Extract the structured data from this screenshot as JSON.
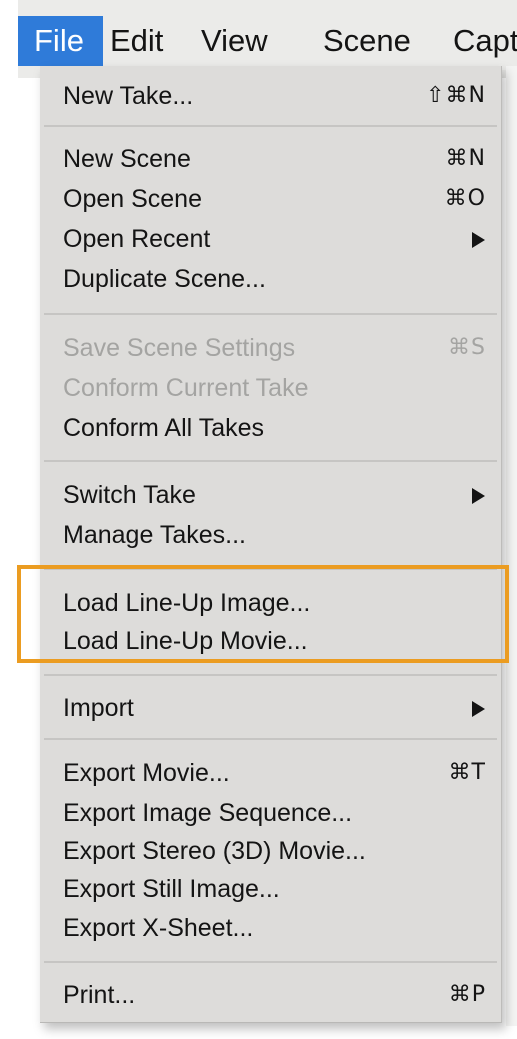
{
  "menubar": {
    "items": [
      {
        "label": "File",
        "active": true
      },
      {
        "label": "Edit"
      },
      {
        "label": "View"
      },
      {
        "label": "Scene"
      },
      {
        "label": "Capt"
      }
    ]
  },
  "file_menu": {
    "new_take": {
      "label": "New Take...",
      "shortcut": "⇧⌘N"
    },
    "new_scene": {
      "label": "New Scene",
      "shortcut": "⌘N"
    },
    "open_scene": {
      "label": "Open Scene",
      "shortcut": "⌘O"
    },
    "open_recent": {
      "label": "Open Recent"
    },
    "duplicate_scene": {
      "label": "Duplicate Scene..."
    },
    "save_scene_settings": {
      "label": "Save Scene Settings",
      "shortcut": "⌘S",
      "enabled": false
    },
    "conform_current_take": {
      "label": "Conform Current Take",
      "enabled": false
    },
    "conform_all_takes": {
      "label": "Conform All Takes"
    },
    "switch_take": {
      "label": "Switch Take"
    },
    "manage_takes": {
      "label": "Manage Takes..."
    },
    "load_lineup_image": {
      "label": "Load Line-Up Image..."
    },
    "load_lineup_movie": {
      "label": "Load Line-Up Movie..."
    },
    "import": {
      "label": "Import"
    },
    "export_movie": {
      "label": "Export Movie...",
      "shortcut": "⌘T"
    },
    "export_image_sequence": {
      "label": "Export Image Sequence..."
    },
    "export_stereo_movie": {
      "label": "Export Stereo (3D) Movie..."
    },
    "export_still_image": {
      "label": "Export Still Image..."
    },
    "export_xsheet": {
      "label": "Export X-Sheet..."
    },
    "print": {
      "label": "Print...",
      "shortcut": "⌘P"
    }
  },
  "highlight_color": "#eb9c21",
  "selection_color": "#2f7bd9"
}
